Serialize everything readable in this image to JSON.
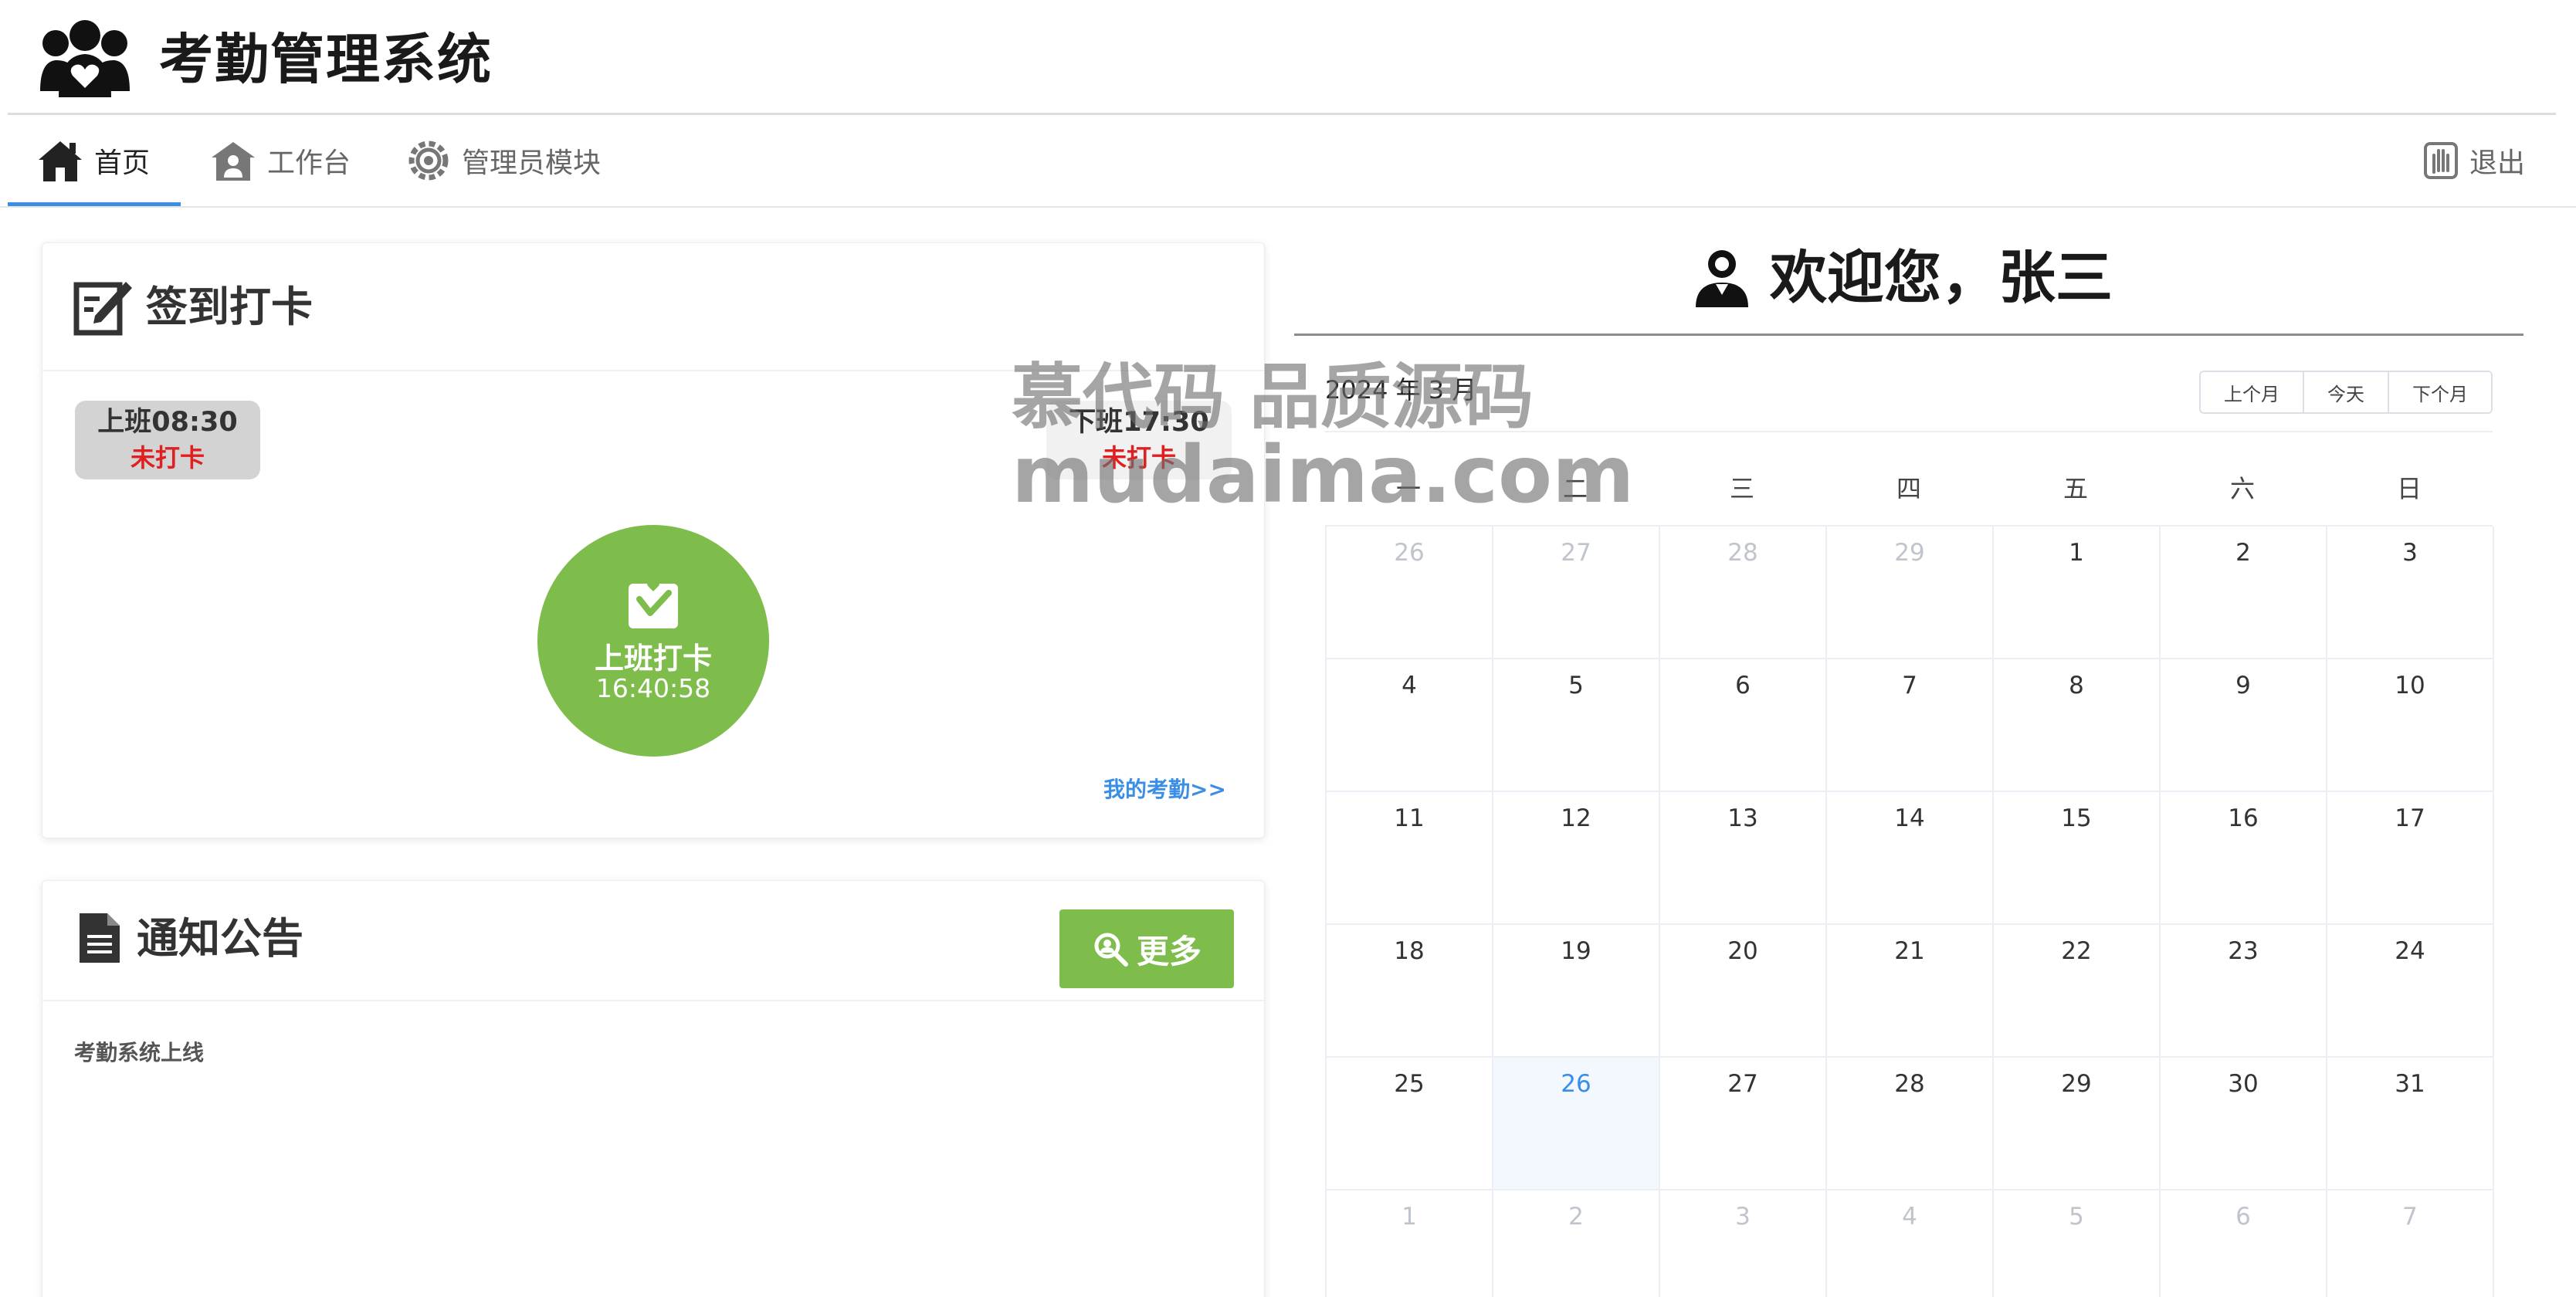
{
  "app": {
    "title": "考勤管理系统",
    "logo_icon": "team-heart-icon"
  },
  "nav": {
    "items": [
      {
        "label": "首页",
        "icon": "home-icon",
        "active": true
      },
      {
        "label": "工作台",
        "icon": "workbench-icon",
        "active": false
      },
      {
        "label": "管理员模块",
        "icon": "gear-icon",
        "active": false
      }
    ],
    "logout": {
      "label": "退出",
      "icon": "logout-hand-icon"
    }
  },
  "checkin": {
    "title": "签到打卡",
    "title_icon": "edit-sign-icon",
    "shifts": [
      {
        "time": "上班08:30",
        "status": "未打卡"
      },
      {
        "time": "下班17:30",
        "status": "未打卡"
      }
    ],
    "punch": {
      "label": "上班打卡",
      "time": "16:40:58",
      "icon": "checkbox-heart-icon"
    },
    "my_attendance_link": "我的考勤>>"
  },
  "notice": {
    "title": "通知公告",
    "title_icon": "document-icon",
    "more_label": "更多",
    "more_icon": "search-icon",
    "items": [
      "考勤系统上线"
    ]
  },
  "welcome": {
    "text": "欢迎您，张三",
    "icon": "user-icon"
  },
  "calendar": {
    "month_label": "2024 年 3 月",
    "buttons": {
      "prev": "上个月",
      "today": "今天",
      "next": "下个月"
    },
    "weekdays": [
      "一",
      "二",
      "三",
      "四",
      "五",
      "六",
      "日"
    ],
    "weeks": [
      [
        "26",
        "27",
        "28",
        "29",
        "1",
        "2",
        "3"
      ],
      [
        "4",
        "5",
        "6",
        "7",
        "8",
        "9",
        "10"
      ],
      [
        "11",
        "12",
        "13",
        "14",
        "15",
        "16",
        "17"
      ],
      [
        "18",
        "19",
        "20",
        "21",
        "22",
        "23",
        "24"
      ],
      [
        "25",
        "26",
        "27",
        "28",
        "29",
        "30",
        "31"
      ],
      [
        "1",
        "2",
        "3",
        "4",
        "5",
        "6",
        "7"
      ]
    ],
    "muted_cells": [
      [
        0,
        0
      ],
      [
        0,
        1
      ],
      [
        0,
        2
      ],
      [
        0,
        3
      ],
      [
        5,
        0
      ],
      [
        5,
        1
      ],
      [
        5,
        2
      ],
      [
        5,
        3
      ],
      [
        5,
        4
      ],
      [
        5,
        5
      ],
      [
        5,
        6
      ]
    ],
    "today_cell": [
      4,
      1
    ],
    "accent_color": "#3a8ee6"
  },
  "watermark": {
    "line1": "慕代码 品质源码",
    "line2": "mudaima.com"
  },
  "colors": {
    "primary_green": "#7ebd4c",
    "danger_red": "#e02020",
    "link_blue": "#3a8ee6"
  }
}
